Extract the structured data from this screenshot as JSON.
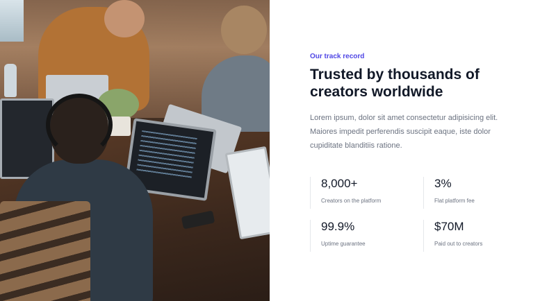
{
  "section": {
    "eyebrow": "Our track record",
    "heading": "Trusted by thousands of creators worldwide",
    "description": "Lorem ipsum, dolor sit amet consectetur adipisicing elit. Maiores impedit perferendis suscipit eaque, iste dolor cupiditate blanditiis ratione."
  },
  "stats": [
    {
      "value": "8,000+",
      "label": "Creators on the platform"
    },
    {
      "value": "3%",
      "label": "Flat platform fee"
    },
    {
      "value": "99.9%",
      "label": "Uptime guarantee"
    },
    {
      "value": "$70M",
      "label": "Paid out to creators"
    }
  ],
  "colors": {
    "accent": "#4f46e5",
    "heading": "#111827",
    "body_text": "#6b7280",
    "divider": "#e5e7eb"
  }
}
